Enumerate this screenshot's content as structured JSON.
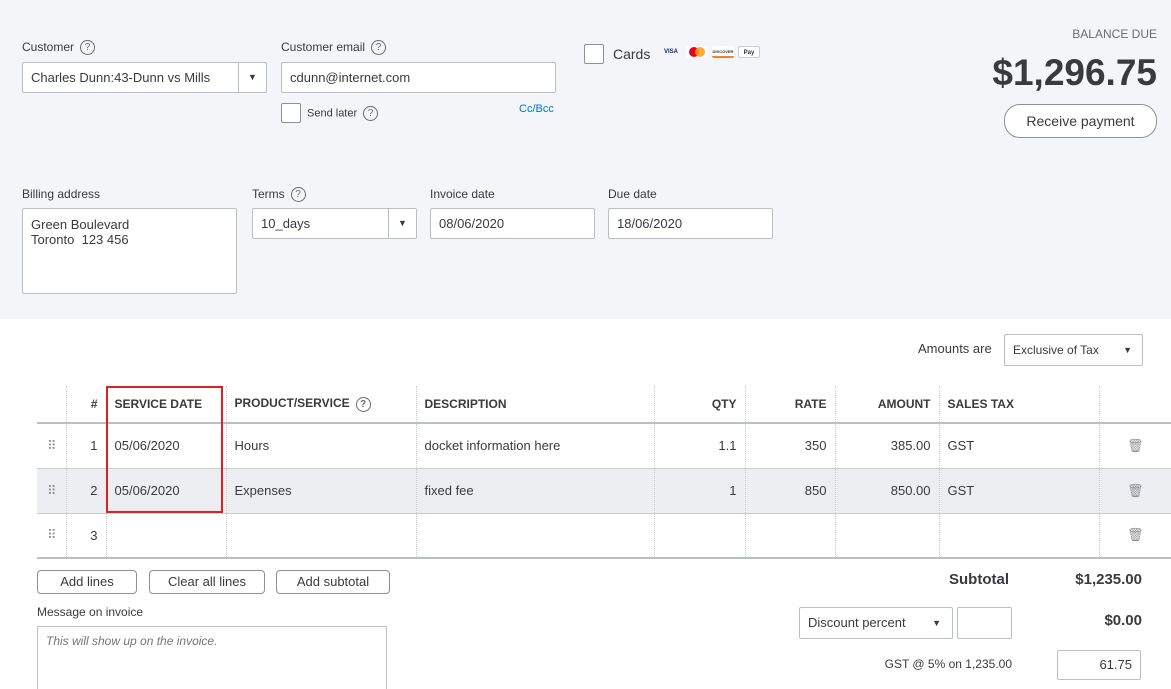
{
  "customer": {
    "label": "Customer",
    "value": "Charles Dunn:43-Dunn vs Mills"
  },
  "customer_email": {
    "label": "Customer email",
    "value": "cdunn@internet.com",
    "send_later_label": "Send later",
    "cc_bcc": "Cc/Bcc"
  },
  "cards": {
    "label": "Cards",
    "logos": [
      "VISA",
      "MC",
      "DISCOVER",
      "Apple Pay"
    ]
  },
  "balance": {
    "label": "BALANCE DUE",
    "amount": "$1,296.75",
    "receive_payment": "Receive payment"
  },
  "billing_address": {
    "label": "Billing address",
    "line1": "Green Boulevard",
    "line2": "Toronto  123 456"
  },
  "terms": {
    "label": "Terms",
    "value": "10_days"
  },
  "invoice_date": {
    "label": "Invoice date",
    "value": "08/06/2020"
  },
  "due_date": {
    "label": "Due date",
    "value": "18/06/2020"
  },
  "amounts_are": {
    "label": "Amounts are",
    "value": "Exclusive of Tax"
  },
  "table": {
    "headers": [
      "#",
      "SERVICE DATE",
      "PRODUCT/SERVICE",
      "DESCRIPTION",
      "QTY",
      "RATE",
      "AMOUNT",
      "SALES TAX"
    ],
    "rows": [
      {
        "num": "1",
        "date": "05/06/2020",
        "product": "Hours",
        "description": "docket information here",
        "qty": "1.1",
        "rate": "350",
        "amount": "385.00",
        "tax": "GST"
      },
      {
        "num": "2",
        "date": "05/06/2020",
        "product": "Expenses",
        "description": "fixed fee",
        "qty": "1",
        "rate": "850",
        "amount": "850.00",
        "tax": "GST"
      },
      {
        "num": "3",
        "date": "",
        "product": "",
        "description": "",
        "qty": "",
        "rate": "",
        "amount": "",
        "tax": ""
      }
    ]
  },
  "actions": {
    "add_lines": "Add lines",
    "clear_all_lines": "Clear all lines",
    "add_subtotal": "Add subtotal"
  },
  "message": {
    "label": "Message on invoice",
    "placeholder": "This will show up on the invoice."
  },
  "totals": {
    "subtotal_label": "Subtotal",
    "subtotal_value": "$1,235.00",
    "discount_type": "Discount percent",
    "discount_value": "$0.00",
    "gst_label": "GST @ 5% on 1,235.00",
    "gst_value": "61.75"
  },
  "colors": {
    "highlight_box": "#e02020",
    "top_panel": "#f4f5f8"
  }
}
